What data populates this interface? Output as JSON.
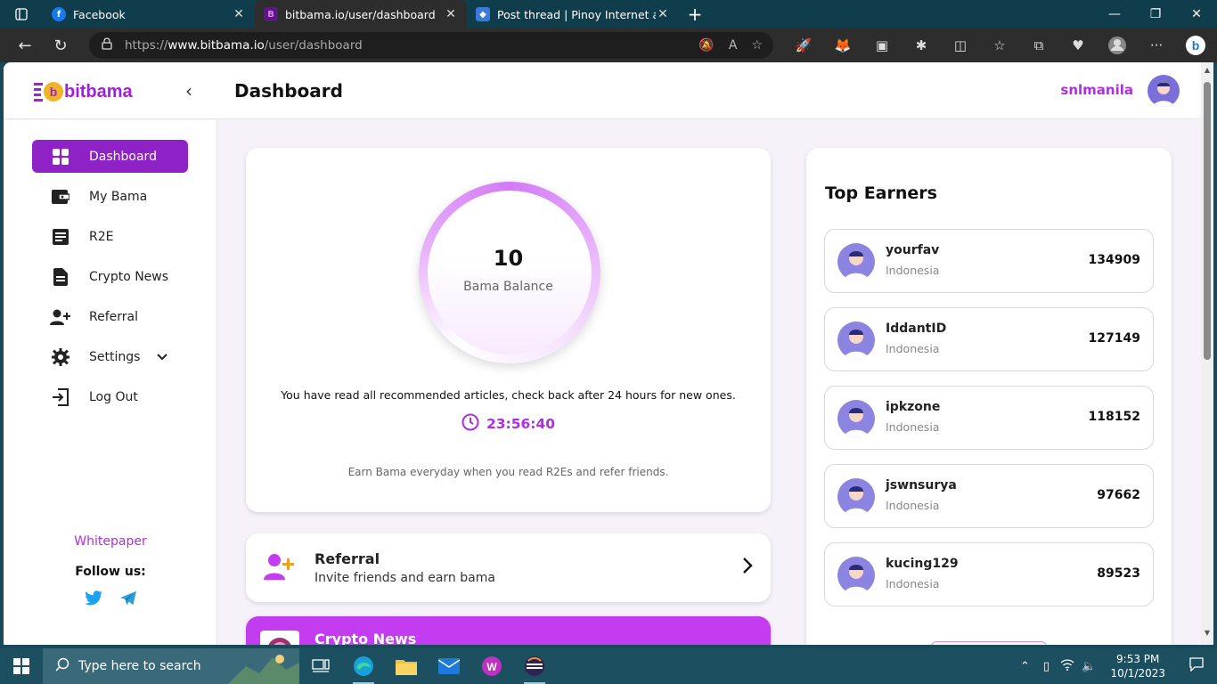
{
  "browser": {
    "tabs": [
      {
        "title": "Facebook",
        "active": false
      },
      {
        "title": "bitbama.io/user/dashboard",
        "active": true
      },
      {
        "title": "Post thread | Pinoy Internet and",
        "active": false
      }
    ],
    "url_scheme": "https://",
    "url_host": "www.bitbama.io",
    "url_path": "/user/dashboard"
  },
  "header": {
    "logo_text": "bitbama",
    "page_title": "Dashboard",
    "username": "snlmanila"
  },
  "sidebar": {
    "items": [
      {
        "label": "Dashboard",
        "icon": "grid-icon",
        "active": true
      },
      {
        "label": "My Bama",
        "icon": "wallet-icon",
        "active": false
      },
      {
        "label": "R2E",
        "icon": "article-icon",
        "active": false
      },
      {
        "label": "Crypto News",
        "icon": "document-icon",
        "active": false
      },
      {
        "label": "Referral",
        "icon": "add-user-icon",
        "active": false
      },
      {
        "label": "Settings",
        "icon": "gear-icon",
        "active": false
      },
      {
        "label": "Log Out",
        "icon": "logout-icon",
        "active": false
      }
    ],
    "whitepaper": "Whitepaper",
    "follow_us": "Follow us:"
  },
  "balance": {
    "value": "10",
    "label": "Bama Balance",
    "message": "You have read all recommended articles, check back after 24 hours for new ones.",
    "timer": "23:56:40",
    "earn_message": "Earn Bama everyday when you read R2Es and refer friends."
  },
  "referral": {
    "title": "Referral",
    "subtitle": "Invite friends and earn bama"
  },
  "crypto_news": {
    "title": "Crypto News"
  },
  "top_earners": {
    "title": "Top Earners",
    "rows": [
      {
        "name": "yourfav",
        "country": "Indonesia",
        "score": "134909"
      },
      {
        "name": "IddantID",
        "country": "Indonesia",
        "score": "127149"
      },
      {
        "name": "ipkzone",
        "country": "Indonesia",
        "score": "118152"
      },
      {
        "name": "jswnsurya",
        "country": "Indonesia",
        "score": "97662"
      },
      {
        "name": "kucing129",
        "country": "Indonesia",
        "score": "89523"
      }
    ]
  },
  "taskbar": {
    "search_placeholder": "Type here to search",
    "time": "9:53 PM",
    "date": "10/1/2023"
  },
  "colors": {
    "brand": "#a020d8",
    "active_nav": "#8f22c6",
    "crypto_card": "#c33cf0"
  }
}
